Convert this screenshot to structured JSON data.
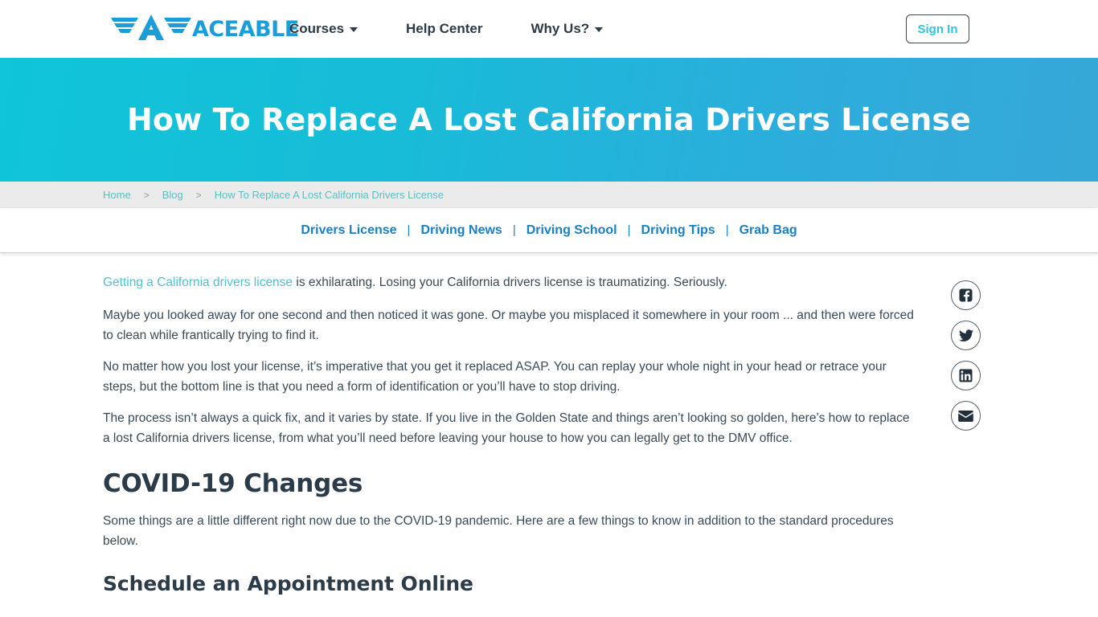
{
  "header": {
    "logo_text": "ACEABLE",
    "logo_icon": "aceable-winged-a-logo",
    "nav": [
      {
        "label": "Courses",
        "has_caret": true
      },
      {
        "label": "Help Center",
        "has_caret": false
      },
      {
        "label": "Why Us?",
        "has_caret": true
      }
    ],
    "signin_label": "Sign In"
  },
  "hero": {
    "title": "How To Replace A Lost California Drivers License",
    "gradient_from": "#10c5d7",
    "gradient_to": "#36a8d8"
  },
  "breadcrumb": {
    "separator": ">",
    "items": [
      {
        "label": "Home"
      },
      {
        "label": "Blog"
      },
      {
        "label": "How To Replace A Lost California Drivers License"
      }
    ]
  },
  "category_nav": {
    "separator": "|",
    "items": [
      {
        "label": "Drivers License"
      },
      {
        "label": "Driving News"
      },
      {
        "label": "Driving School"
      },
      {
        "label": "Driving Tips"
      },
      {
        "label": "Grab Bag"
      }
    ],
    "link_color": "#1b7fc4"
  },
  "article": {
    "p1_link": "Getting a California drivers license",
    "p1_rest": " is exhilarating. Losing your California drivers license is traumatizing. Seriously.",
    "p2": "Maybe you looked away for one second and then noticed it was gone. Or maybe you misplaced it somewhere in your room ... and then were forced to clean while frantically trying to find it.",
    "p3": "No matter how you lost your license, it’s imperative that you get it replaced ASAP. You can replay your whole night in your head or retrace your steps, but the bottom line is that you need a form of identification or you’ll have to stop driving.",
    "p4": "The process isn’t always a quick fix, and it varies by state. If you live in the Golden State and things aren’t looking so golden, here’s how to replace a lost California drivers license, from what you’ll need before leaving your house to how you can legally get to the DMV office.",
    "h2_covid": "COVID-19 Changes",
    "p5": "Some things are a little different right now due to the COVID-19 pandemic. Here are a few things to know in addition to the standard procedures below.",
    "h3_schedule": "Schedule an Appointment Online"
  },
  "share": {
    "items": [
      {
        "icon": "facebook-icon",
        "label": "Share on Facebook"
      },
      {
        "icon": "twitter-icon",
        "label": "Share on Twitter"
      },
      {
        "icon": "linkedin-icon",
        "label": "Share on LinkedIn"
      },
      {
        "icon": "email-icon",
        "label": "Share by Email"
      }
    ]
  }
}
